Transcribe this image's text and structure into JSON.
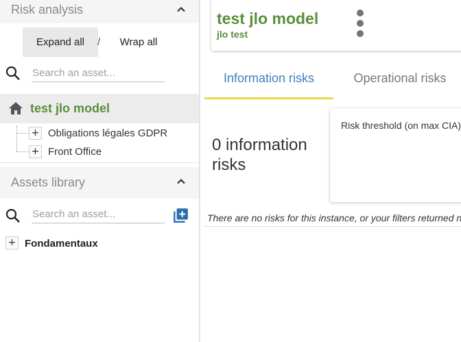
{
  "risk_analysis": {
    "title": "Risk analysis",
    "expand_all": "Expand all",
    "separator": "/",
    "wrap_all": "Wrap all",
    "search_placeholder": "Search an asset...",
    "model": {
      "label": "test jlo model",
      "children": [
        {
          "label": "Obligations légales GDPR"
        },
        {
          "label": "Front Office"
        }
      ]
    }
  },
  "assets_library": {
    "title": "Assets library",
    "search_placeholder": "Search an asset...",
    "items": [
      {
        "label": "Fondamentaux"
      }
    ]
  },
  "header": {
    "title": "test jlo model",
    "subtitle": "jlo test"
  },
  "tabs": [
    {
      "label": "Information risks",
      "active": true
    },
    {
      "label": "Operational risks",
      "active": false
    }
  ],
  "main": {
    "count_label": "0 information risks",
    "threshold_label": "Risk threshold (on max CIA)",
    "empty_message": "There are no risks for this instance, or your filters returned no results."
  },
  "colors": {
    "brand_green": "#5a8f3a",
    "tab_blue": "#3f7fbf",
    "tab_underline": "#e8d84a",
    "add_icon_blue": "#2b6cb0"
  },
  "icons": {
    "collapse": "chevron-up-icon",
    "search": "search-icon",
    "home": "home-icon",
    "expand_node": "plus-icon",
    "add": "add-box-icon",
    "menu": "more-vertical-icon"
  }
}
